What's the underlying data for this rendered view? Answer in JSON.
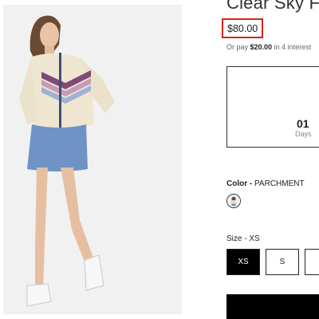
{
  "product": {
    "title": "Clear Sky Fu",
    "price": "$80.00",
    "installment_prefix": "Or pay ",
    "installment_amount": "$20.00",
    "installment_suffix": " in 4 interest"
  },
  "countdown": {
    "number": "01",
    "unit": "Days"
  },
  "color": {
    "label": "Color -",
    "value": "PARCHMENT"
  },
  "size": {
    "label": "Size - XS",
    "options": [
      "XS",
      "S"
    ],
    "selected": "XS"
  },
  "colors": {
    "price_highlight": "#d8231c",
    "skirt": "#6e93c4",
    "jacket": "#efe6d2"
  }
}
